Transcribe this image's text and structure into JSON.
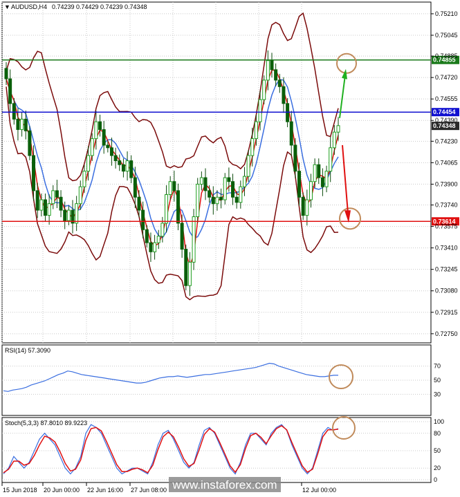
{
  "chart_data": {
    "type": "candlestick",
    "symbol_header": "AUDUSD,H4",
    "ohlc": {
      "open": "0.74239",
      "high": "0.74429",
      "low": "0.74239",
      "close": "0.74348"
    },
    "y_ticks": [
      "0.75210",
      "0.75045",
      "0.74885",
      "0.74720",
      "0.74555",
      "0.74390",
      "0.74230",
      "0.74065",
      "0.73900",
      "0.73740",
      "0.73575",
      "0.73410",
      "0.73245",
      "0.73080",
      "0.72915",
      "0.72750"
    ],
    "ylim": [
      0.7268,
      0.753
    ],
    "x_ticks": [
      "15 Jun 2018",
      "20 Jun 00:00",
      "22 Jun 16:00",
      "27 Jun 08:00",
      "",
      "",
      "",
      "12 Jul 00:00"
    ],
    "levels": [
      {
        "label": "0.74855",
        "value": 0.74855,
        "color": "#1a7a1a"
      },
      {
        "label": "0.74454",
        "value": 0.74454,
        "color": "#1010d0"
      },
      {
        "label": "0.74348",
        "value": 0.74348,
        "color": "#2a2a2a"
      },
      {
        "label": "0.73614",
        "value": 0.73614,
        "color": "#e01010"
      }
    ],
    "closes": [
      0.7471,
      0.7452,
      0.744,
      0.7432,
      0.744,
      0.7431,
      0.7412,
      0.7385,
      0.737,
      0.7378,
      0.7366,
      0.7375,
      0.7385,
      0.738,
      0.737,
      0.7362,
      0.737,
      0.736,
      0.7375,
      0.7388,
      0.74,
      0.7412,
      0.7425,
      0.7438,
      0.7432,
      0.742,
      0.7418,
      0.7412,
      0.7408,
      0.7405,
      0.74,
      0.7408,
      0.7395,
      0.738,
      0.737,
      0.7355,
      0.7345,
      0.7338,
      0.7345,
      0.735,
      0.736,
      0.7382,
      0.7392,
      0.7385,
      0.736,
      0.734,
      0.7312,
      0.733,
      0.7365,
      0.739,
      0.7395,
      0.7385,
      0.738,
      0.7375,
      0.738,
      0.7378,
      0.7395,
      0.7392,
      0.738,
      0.7376,
      0.7388,
      0.7396,
      0.7412,
      0.7425,
      0.7438,
      0.7455,
      0.747,
      0.7485,
      0.7478,
      0.747,
      0.7465,
      0.7452,
      0.7438,
      0.742,
      0.74,
      0.738,
      0.7366,
      0.7378,
      0.7392,
      0.7405,
      0.7395,
      0.7388,
      0.74,
      0.7418,
      0.743,
      0.7435
    ],
    "rsi": {
      "label": "RSI(14) 57.3090",
      "levels": [
        "70",
        "50",
        "30"
      ],
      "ylim": [
        0,
        100
      ],
      "values": [
        35,
        34,
        36,
        37,
        38,
        40,
        43,
        45,
        47,
        49,
        52,
        55,
        58,
        60,
        63,
        62,
        60,
        58,
        57,
        56,
        55,
        54,
        53,
        52,
        51,
        50,
        49,
        48,
        47,
        46,
        46,
        47,
        49,
        51,
        53,
        54,
        55,
        55,
        56,
        55,
        54,
        55,
        56,
        57,
        58,
        58,
        59,
        60,
        61,
        62,
        63,
        64,
        65,
        66,
        67,
        68,
        70,
        72,
        74,
        73,
        70,
        68,
        66,
        64,
        62,
        60,
        58,
        57,
        56,
        55,
        55,
        56,
        57,
        57
      ]
    },
    "stoch": {
      "label": "Stoch(5,3,3) 87.8010 89.9223",
      "levels": [
        "100",
        "80",
        "50",
        "20",
        "0"
      ],
      "ylim": [
        0,
        100
      ],
      "main": [
        10,
        20,
        40,
        30,
        20,
        30,
        50,
        70,
        80,
        70,
        60,
        40,
        20,
        10,
        20,
        40,
        80,
        95,
        90,
        80,
        60,
        40,
        20,
        10,
        15,
        20,
        20,
        15,
        10,
        30,
        60,
        80,
        85,
        70,
        50,
        30,
        20,
        30,
        60,
        85,
        90,
        80,
        60,
        40,
        20,
        10,
        30,
        60,
        80,
        80,
        70,
        60,
        80,
        90,
        95,
        85,
        60,
        40,
        20,
        10,
        20,
        50,
        80,
        90,
        85,
        88
      ],
      "signal": [
        12,
        18,
        32,
        32,
        25,
        28,
        42,
        60,
        75,
        72,
        65,
        48,
        28,
        15,
        18,
        34,
        68,
        88,
        90,
        84,
        66,
        46,
        26,
        14,
        14,
        18,
        20,
        17,
        12,
        25,
        52,
        74,
        82,
        74,
        56,
        36,
        23,
        28,
        52,
        78,
        88,
        82,
        64,
        44,
        24,
        13,
        26,
        54,
        76,
        80,
        73,
        62,
        76,
        88,
        93,
        86,
        64,
        44,
        24,
        13,
        18,
        44,
        74,
        86,
        86,
        87
      ]
    }
  },
  "watermark": "www.instaforex.com",
  "colors": {
    "bull": "#1e9e1e",
    "bear": "#0a5f0a",
    "ma_fast": "#e01010",
    "ma_slow": "#3a6ee0",
    "bands": "#7a0a0a",
    "circle": "#c08a5a",
    "arrow_up": "#1fb01f",
    "arrow_down": "#e01010"
  }
}
